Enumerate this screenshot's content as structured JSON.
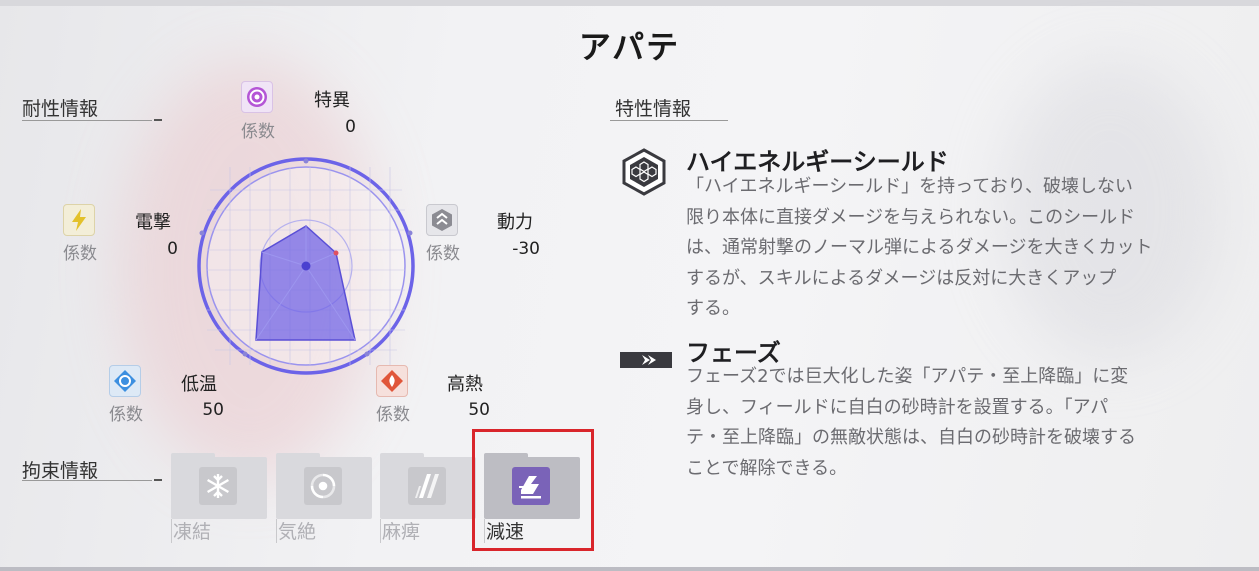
{
  "title": "アパテ",
  "resistance": {
    "section_title": "耐性情報",
    "coef_label": "係数",
    "stats": [
      {
        "key": "special",
        "name": "特異",
        "value": "0",
        "icon": "special-swirl-icon",
        "color": "#b455d6"
      },
      {
        "key": "electric",
        "name": "電撃",
        "value": "0",
        "icon": "lightning-icon",
        "color": "#e3c12b"
      },
      {
        "key": "kinetic",
        "name": "動力",
        "value": "-30",
        "icon": "kinetic-icon",
        "color": "#8c8c93"
      },
      {
        "key": "cold",
        "name": "低温",
        "value": "50",
        "icon": "snowflake-icon",
        "color": "#3c8fe0"
      },
      {
        "key": "heat",
        "name": "高熱",
        "value": "50",
        "icon": "flame-icon",
        "color": "#e0563a"
      }
    ]
  },
  "restraint": {
    "section_title": "拘束情報",
    "items": [
      {
        "label": "凍結",
        "icon": "freeze-icon",
        "active": false
      },
      {
        "label": "気絶",
        "icon": "stun-icon",
        "active": false
      },
      {
        "label": "麻痺",
        "icon": "paralyze-icon",
        "active": false
      },
      {
        "label": "減速",
        "icon": "slow-icon",
        "active": true
      }
    ]
  },
  "traits": {
    "section_title": "特性情報",
    "items": [
      {
        "name": "ハイエネルギーシールド",
        "icon": "hex-shield-icon",
        "description_lines": [
          "「ハイエネルギーシールド」を持っており、破壊しない",
          "限り本体に直接ダメージを与えられない。このシールド",
          "は、通常射撃のノーマル弾によるダメージを大きくカット",
          "するが、スキルによるダメージは反対に大きくアップ",
          "する。"
        ]
      },
      {
        "name": "フェーズ",
        "icon": "phase-arrow-icon",
        "description_lines": [
          "フェーズ2では巨大化した姿「アパテ・至上降臨」に変",
          "身し、フィールドに自白の砂時計を設置する。「アパ",
          "テ・至上降臨」の無敵状態は、自白の砂時計を破壊する",
          "ことで解除できる。"
        ]
      }
    ]
  },
  "colors": {
    "radar_fill": "#6f63e6",
    "radar_ring": "#6c63e8",
    "highlight": "#d9252b",
    "active_restraint": "#7a63b8"
  }
}
